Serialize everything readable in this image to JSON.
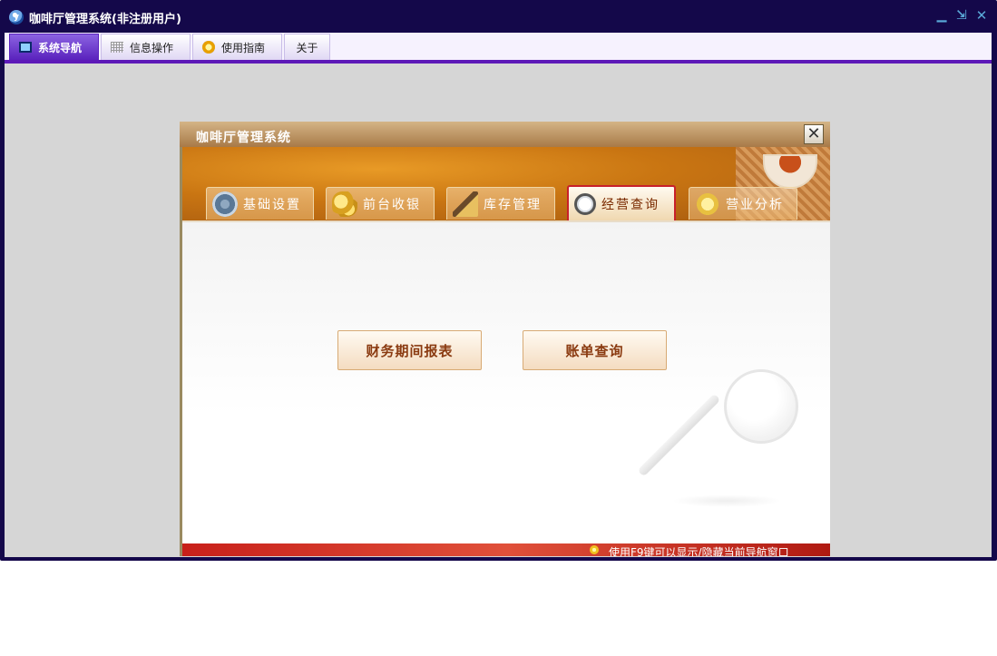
{
  "app": {
    "title": "咖啡厅管理系统(非注册用户)",
    "logo_icon": "coffee-logo-icon",
    "controls": {
      "minimize": "▁",
      "restore": "⇲",
      "close": "✕"
    }
  },
  "menu": {
    "tabs": [
      {
        "label": "系统导航",
        "icon": "monitor-icon",
        "active": true
      },
      {
        "label": "信息操作",
        "icon": "grid-icon",
        "active": false
      },
      {
        "label": "使用指南",
        "icon": "clock-icon",
        "active": false
      },
      {
        "label": "关于",
        "icon": "",
        "active": false
      }
    ],
    "accent_color": "#5d19b8"
  },
  "dialog": {
    "title": "咖啡厅管理系统",
    "close_symbol": "✕",
    "module_tabs": [
      {
        "label": "基础设置",
        "icon": "gear-icon",
        "active": false
      },
      {
        "label": "前台收银",
        "icon": "coins-icon",
        "active": false
      },
      {
        "label": "库存管理",
        "icon": "house-icon",
        "active": false
      },
      {
        "label": "经营查询",
        "icon": "magnifier-icon",
        "active": true
      },
      {
        "label": "营业分析",
        "icon": "star-icon",
        "active": false
      }
    ],
    "buttons": {
      "finance_report": "财务期间报表",
      "bill_query": "账单查询"
    },
    "status_text": "使用F9键可以显示/隐藏当前导航窗口",
    "status_icon": "lightbulb-icon"
  }
}
